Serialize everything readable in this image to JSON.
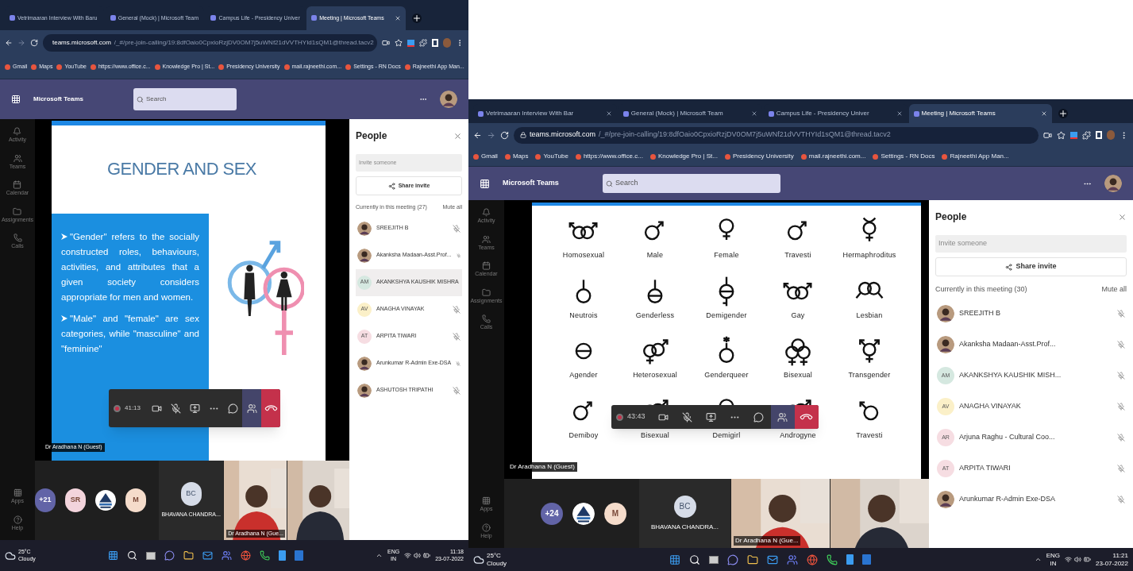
{
  "screens": [
    {
      "browser": {
        "tabs": [
          {
            "title": "Vetrimaaran Interview With Baru",
            "selected": false
          },
          {
            "title": "General (Mock) | Microsoft Team",
            "selected": false
          },
          {
            "title": "Campus Life - Presidency Univer",
            "selected": false
          },
          {
            "title": "Meeting | Microsoft Teams",
            "selected": true
          }
        ],
        "url_host": "teams.microsoft.com",
        "url_path": "/_#/pre-join-calling/19:8dfOaio0CpxioRzjDV0OM7j5uWNf21dVVTHYId1sQM1@thread.tacv2",
        "bookmarks": [
          "Gmail",
          "Maps",
          "YouTube",
          "https://www.office.c...",
          "Knowledge Pro | St...",
          "Presidency University",
          "mail.rajneethi.com...",
          "Settings - RN Docs",
          "Rajneethi App Man..."
        ]
      },
      "teams": {
        "app_name": "Microsoft Teams",
        "search_placeholder": "Search",
        "rail": [
          "Activity",
          "Teams",
          "Calendar",
          "Assignments",
          "Calls",
          "Apps",
          "Help"
        ]
      },
      "slide": {
        "kind": "text",
        "title": "GENDER AND SEX",
        "bullets": [
          "\"Gender\" refers to the socially constructed roles, behaviours, activities, and attributes that a given society considers appropriate for men and women.",
          "\"Male\" and \"female\" are sex categories, while \"masculine\" and \"feminine\""
        ]
      },
      "call_controls": {
        "timer": "41:13"
      },
      "presenter_label": "Dr Aradhana N (Guest)",
      "strip": [
        {
          "kind": "avatar",
          "label": "+21",
          "color": "#6264a7"
        },
        {
          "kind": "avatar",
          "label": "SR",
          "color": "#f3d4dc"
        },
        {
          "kind": "logo"
        },
        {
          "kind": "avatar",
          "label": "M",
          "color": "#f5dccb"
        },
        {
          "kind": "tile",
          "initials": "BC",
          "name": "BHAVANA CHANDRA..."
        },
        {
          "kind": "video",
          "name": "Dr Aradhana N (Gue..."
        },
        {
          "kind": "video"
        }
      ],
      "people": {
        "title": "People",
        "invite_placeholder": "Invite someone",
        "share": "Share invite",
        "section": "Currently in this meeting (27)",
        "mute_all": "Mute all",
        "participants": [
          {
            "name": "SREEJITH B",
            "hovered": false
          },
          {
            "name": "Akanksha Madaan-Asst.Prof...",
            "hovered": false
          },
          {
            "name": "AKANKSHYA KAUSHIK MISHRA",
            "kind": "initials",
            "initials": "AM",
            "color": "#d5e8e0",
            "hovered": true
          },
          {
            "name": "ANAGHA VINAYAK",
            "kind": "initials",
            "initials": "AV",
            "color": "#fbf0c8",
            "hovered": false
          },
          {
            "name": "ARPITA TIWARI",
            "kind": "initials",
            "initials": "AT",
            "color": "#f6dde2",
            "hovered": false
          },
          {
            "name": "Arunkumar R-Admin Exe-DSA",
            "hovered": false
          },
          {
            "name": "ASHUTOSH TRIPATHI",
            "hovered": false
          }
        ]
      },
      "taskbar": {
        "temperature": "25°C",
        "weather": "Cloudy",
        "lang": "ENG",
        "region": "IN",
        "time": "11:18",
        "date": "23-07-2022"
      }
    },
    {
      "browser": {
        "tabs": [
          {
            "title": "Vetrimaaran Interview With Bar",
            "selected": false
          },
          {
            "title": "General (Mock) | Microsoft Team",
            "selected": false
          },
          {
            "title": "Campus Life - Presidency Univer",
            "selected": false
          },
          {
            "title": "Meeting | Microsoft Teams",
            "selected": true
          }
        ],
        "url_host": "teams.microsoft.com",
        "url_path": "/_#/pre-join-calling/19:8dfOaio0CpxioRzjDV0OM7j5uWNf21dVVTHYId1sQM1@thread.tacv2",
        "bookmarks": [
          "Gmail",
          "Maps",
          "YouTube",
          "https://www.office.c...",
          "Knowledge Pro | St...",
          "Presidency University",
          "mail.rajneethi.com...",
          "Settings - RN Docs",
          "Rajneethi App Man..."
        ]
      },
      "teams": {
        "app_name": "Microsoft Teams",
        "search_placeholder": "Search",
        "rail": [
          "Activity",
          "Teams",
          "Calendar",
          "Assignments",
          "Calls",
          "Apps",
          "Help"
        ]
      },
      "slide": {
        "kind": "symbols",
        "symbols": [
          {
            "label": "Homosexual",
            "kind": "two-male"
          },
          {
            "label": "Male",
            "kind": "male"
          },
          {
            "label": "Female",
            "kind": "female"
          },
          {
            "label": "Travesti",
            "kind": "male"
          },
          {
            "label": "Hermaphroditus",
            "kind": "horned"
          },
          {
            "label": "Neutrois",
            "kind": "stem"
          },
          {
            "label": "Genderless",
            "kind": "stem-bar"
          },
          {
            "label": "Demigender",
            "kind": "demi"
          },
          {
            "label": "Gay",
            "kind": "two-male"
          },
          {
            "label": "Lesbian",
            "kind": "two-female"
          },
          {
            "label": "Agender",
            "kind": "bar"
          },
          {
            "label": "Heterosexual",
            "kind": "hetero"
          },
          {
            "label": "Genderqueer",
            "kind": "star"
          },
          {
            "label": "Bisexual",
            "kind": "triple"
          },
          {
            "label": "Transgender",
            "kind": "trans"
          },
          {
            "label": "Demiboy",
            "kind": "male"
          },
          {
            "label": "Bisexual",
            "kind": "hetero"
          },
          {
            "label": "Demigirl",
            "kind": "female"
          },
          {
            "label": "Androgyne",
            "kind": "hetero"
          },
          {
            "label": "Travesti",
            "kind": "male-left"
          }
        ]
      },
      "call_controls": {
        "timer": "43:43"
      },
      "presenter_label": "Dr Aradhana N (Guest)",
      "strip": [
        {
          "kind": "avatar",
          "label": "+24",
          "color": "#6264a7"
        },
        {
          "kind": "logo"
        },
        {
          "kind": "avatar",
          "label": "M",
          "color": "#f5dccb"
        },
        {
          "kind": "tile",
          "initials": "BC",
          "name": "BHAVANA CHANDRA..."
        },
        {
          "kind": "video",
          "name": "Dr Aradhana N (Gue..."
        },
        {
          "kind": "video"
        }
      ],
      "people": {
        "title": "People",
        "invite_placeholder": "Invite someone",
        "share": "Share invite",
        "section": "Currently in this meeting (30)",
        "mute_all": "Mute all",
        "participants": [
          {
            "name": "SREEJITH B",
            "hovered": false
          },
          {
            "name": "Akanksha Madaan-Asst.Prof...",
            "hovered": false
          },
          {
            "name": "AKANKSHYA KAUSHIK MISH...",
            "kind": "initials",
            "initials": "AM",
            "color": "#d5e8e0",
            "hovered": false
          },
          {
            "name": "ANAGHA VINAYAK",
            "kind": "initials",
            "initials": "AV",
            "color": "#fbf0c8",
            "hovered": false
          },
          {
            "name": "Arjuna Raghu - Cultural Coo...",
            "kind": "initials",
            "initials": "AR",
            "color": "#f6dde2",
            "hovered": false
          },
          {
            "name": "ARPITA TIWARI",
            "kind": "initials",
            "initials": "AT",
            "color": "#f6dde2",
            "hovered": false
          },
          {
            "name": "Arunkumar R-Admin Exe-DSA",
            "hovered": false
          }
        ]
      },
      "taskbar": {
        "temperature": "25°C",
        "weather": "Cloudy",
        "lang": "ENG",
        "region": "IN",
        "time": "11:21",
        "date": "23-07-2022"
      }
    }
  ]
}
